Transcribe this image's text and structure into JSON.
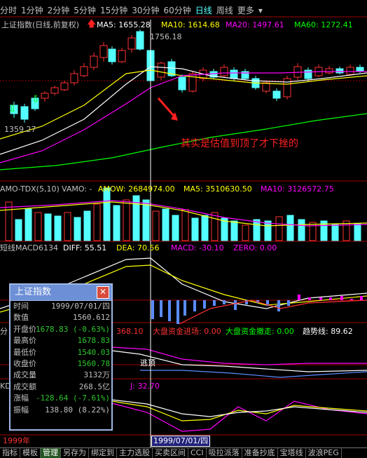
{
  "period_tabs": [
    "分时",
    "1分钟",
    "2分钟",
    "5分钟",
    "15分钟",
    "30分钟",
    "60分钟",
    "日线",
    "周线",
    "更多"
  ],
  "active_tab": "日线",
  "main_header": {
    "title": "上证指数(日线,前复权)",
    "ma5": "MA5: 1655.28",
    "ma10": "MA10: 1614.68",
    "ma20": "MA20: 1497.61",
    "ma60": "MA60: 1272.41"
  },
  "annotations": {
    "high_price": "1756.18",
    "low_price": "1359.27",
    "comment": "其实是估值到顶了才下挫的"
  },
  "vol_header": {
    "name": "AMO-TDX(5,10)",
    "vamo": "VAMO: -",
    "amow": "AMOW: 2684974.00",
    "ma5": "MA5: 3510630.50",
    "ma10": "MA10: 3126572.75"
  },
  "macd_header": {
    "name": "短线MACD6134",
    "diff": "DIFF: 55.51",
    "dea": "DEA: 70.56",
    "macd": "MACD: -30.10",
    "zero": "ZERO: 0.00"
  },
  "fund_header": {
    "prefix": "分",
    "v1": "368.10",
    "in": "大盘资金进场: 0.00",
    "out": "大盘资金撤走: 0.00",
    "trend": "趋势线: 89.62"
  },
  "fund_label": "逃顶",
  "kdj_header": {
    "prefix": "KD",
    "j": "J: 32.70"
  },
  "tooltip": {
    "title": "上证指数",
    "rows": [
      {
        "k": "时间",
        "v": "1999/07/01/四",
        "c": "#c0c0c0"
      },
      {
        "k": "数值",
        "v": "1560.612",
        "c": "#c0c0c0"
      },
      {
        "k": "开盘价",
        "v": "1678.83 (-0.63%)",
        "c": "#2ec82e"
      },
      {
        "k": "最高价",
        "v": "1678.83",
        "c": "#2ec82e"
      },
      {
        "k": "最低价",
        "v": "1540.03",
        "c": "#2ec82e"
      },
      {
        "k": "收盘价",
        "v": "1560.78",
        "c": "#2ec82e"
      },
      {
        "k": "成交量",
        "v": "3132万",
        "c": "#c0c0c0"
      },
      {
        "k": "成交额",
        "v": "268.5亿",
        "c": "#c0c0c0"
      },
      {
        "k": "涨幅",
        "v": "-128.64 (-7.61%)",
        "c": "#2ec82e"
      },
      {
        "k": "振幅",
        "v": "138.80 (8.22%)",
        "c": "#c0c0c0"
      }
    ]
  },
  "axis": {
    "year": "1999年",
    "cursor_date": "1999/07/01/四"
  },
  "bottom_tabs": [
    "指标",
    "模板",
    "管理",
    "另存为",
    "绑定到",
    "主力选股",
    "买卖区间",
    "CCI",
    "吸拉派落",
    "准备抄底",
    "宝塔线",
    "波浪PEG"
  ],
  "colors": {
    "up": "#ff3232",
    "down": "#54ffff",
    "ma5": "#ffffff",
    "ma10": "#ffff00",
    "ma20": "#ff00ff",
    "ma60": "#00ff00",
    "cursor": "#ffffff"
  }
}
